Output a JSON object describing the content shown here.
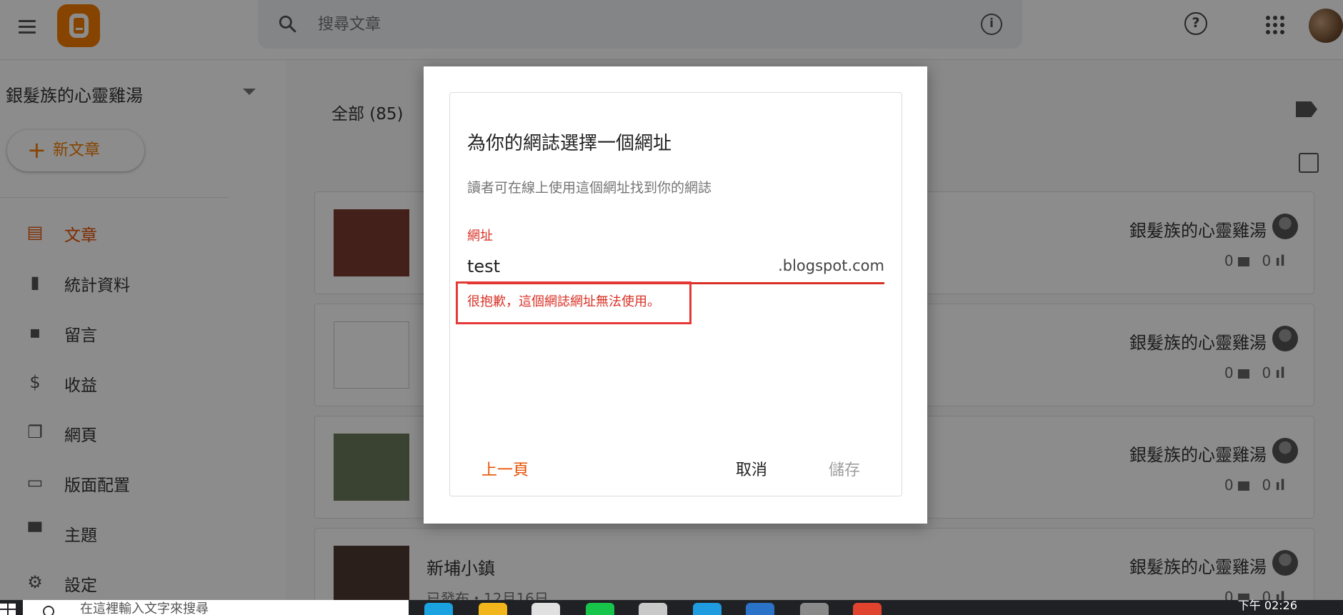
{
  "topbar": {
    "search_placeholder": "搜尋文章",
    "info_glyph": "i",
    "help_glyph": "?"
  },
  "sidebar": {
    "blog_title": "銀髮族的心靈雞湯",
    "new_post_plus": "+",
    "new_post_label": "新文章",
    "items": [
      {
        "label": "文章",
        "icon": "post-icon",
        "glyph": "▤"
      },
      {
        "label": "統計資料",
        "icon": "stats-icon",
        "glyph": "▮"
      },
      {
        "label": "留言",
        "icon": "comment-icon",
        "glyph": "▪"
      },
      {
        "label": "收益",
        "icon": "dollar-icon",
        "glyph": "$"
      },
      {
        "label": "網頁",
        "icon": "pages-icon",
        "glyph": "❐"
      },
      {
        "label": "版面配置",
        "icon": "layout-icon",
        "glyph": "▭"
      },
      {
        "label": "主題",
        "icon": "paint-roller-icon",
        "glyph": "▀"
      },
      {
        "label": "設定",
        "icon": "gear-icon",
        "glyph": "⚙"
      }
    ]
  },
  "main": {
    "count_label": "全部 (85)",
    "posts": [
      {
        "title": "",
        "meta": "",
        "author": "銀髮族的心靈雞湯",
        "comments": "0",
        "views": "0"
      },
      {
        "title": "",
        "meta": "",
        "author": "銀髮族的心靈雞湯",
        "comments": "0",
        "views": "0"
      },
      {
        "title": "",
        "meta": "",
        "author": "銀髮族的心靈雞湯",
        "comments": "0",
        "views": "0"
      },
      {
        "title": "新埔小鎮",
        "meta": "已發布・12月16日",
        "author": "銀髮族的心靈雞湯",
        "comments": "0",
        "views": "0"
      }
    ]
  },
  "dialog": {
    "title": "為你的網誌選擇一個網址",
    "subtitle": "讀者可在線上使用這個網址找到你的網誌",
    "field_label": "網址",
    "url_value": "test",
    "url_suffix": ".blogspot.com",
    "error": "很抱歉，這個網誌網址無法使用。",
    "back_label": "上一頁",
    "cancel_label": "取消",
    "save_label": "儲存"
  },
  "taskbar": {
    "search_text": "在這裡輸入文字來搜尋",
    "clock": "下午 02:26"
  },
  "colors": {
    "accent": "#f57d00",
    "active_nav": "#e65100",
    "error": "#d93025",
    "highlight_box": "#e53935"
  }
}
